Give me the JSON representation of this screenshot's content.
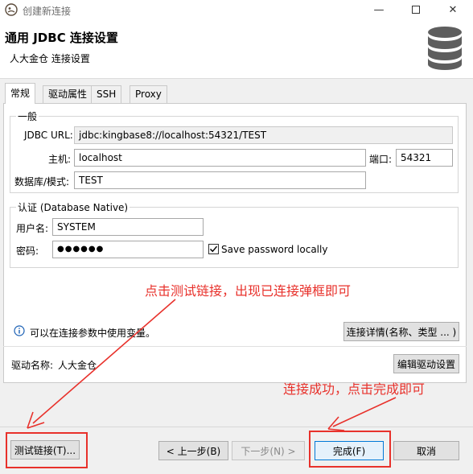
{
  "window": {
    "title": "创建新连接"
  },
  "header": {
    "title": "通用 JDBC 连接设置",
    "subtitle": "人大金仓 连接设置"
  },
  "tabs": [
    {
      "label": "常规"
    },
    {
      "label": "驱动属性"
    },
    {
      "label": "SSH"
    },
    {
      "label": "Proxy"
    }
  ],
  "general": {
    "legend": "一般",
    "jdbc_url_label": "JDBC URL:",
    "jdbc_url_value": "jdbc:kingbase8://localhost:54321/TEST",
    "host_label": "主机:",
    "host_value": "localhost",
    "port_label": "端口:",
    "port_value": "54321",
    "db_label": "数据库/模式:",
    "db_value": "TEST"
  },
  "auth": {
    "legend": "认证 (Database Native)",
    "user_label": "用户名:",
    "user_value": "SYSTEM",
    "password_label": "密码:",
    "password_value": "●●●●●●",
    "save_password_label": "Save password locally",
    "save_password_checked": true
  },
  "info": {
    "text": "可以在连接参数中使用变量。",
    "details_button": "连接详情(名称、类型 ... )"
  },
  "driver": {
    "label": "驱动名称:",
    "value": "人大金仓",
    "edit_button": "编辑驱动设置"
  },
  "footer": {
    "test_button": "测试链接(T)...",
    "back_button": "< 上一步(B)",
    "next_button": "下一步(N) >",
    "finish_button": "完成(F)",
    "cancel_button": "取消"
  },
  "annotations": {
    "note_test": "点击测试链接，出现已连接弹框即可",
    "note_finish": "连接成功，点击完成即可",
    "color": "#e8312b"
  },
  "colors": {
    "primary_border": "#0078d7",
    "annotation": "#e8312b"
  }
}
